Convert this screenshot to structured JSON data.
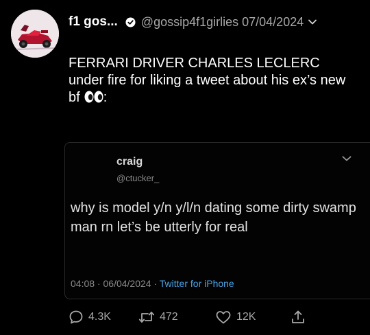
{
  "post": {
    "display_name": "f1 gos...",
    "handle": "@gossip4f1girlies",
    "date": "07/04/2024",
    "text": "FERRARI DRIVER CHARLES LECLERC under fire for liking a tweet about his ex’s new bf",
    "text_suffix": ":",
    "emoji": "eyes-emoji"
  },
  "quote": {
    "name": "craig",
    "handle": "@ctucker_",
    "text": "why is model y/n y/l/n dating some dirty swamp man rn let’s be utterly for real",
    "time": "04:08",
    "separator": "·",
    "date": "06/04/2024",
    "source": "Twitter for iPhone"
  },
  "actions": {
    "replies": "4.3K",
    "reposts": "472",
    "likes": "12K"
  },
  "icons": {
    "verified": "verified-check-icon",
    "menu": "chevron-down-icon",
    "reply": "speech-bubble-icon",
    "repost": "repost-arrows-icon",
    "like": "heart-icon",
    "share": "share-icon"
  },
  "colors": {
    "background": "#000000",
    "text": "#ffffff",
    "muted": "#a8a8a8",
    "link": "#4aa3e6"
  }
}
